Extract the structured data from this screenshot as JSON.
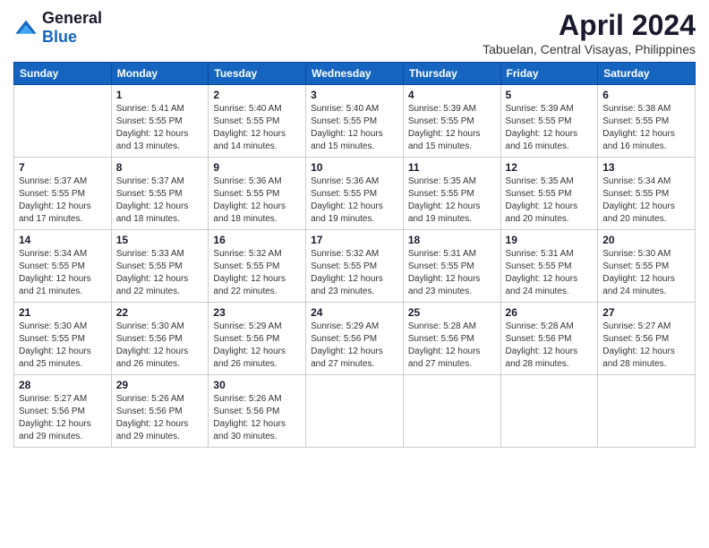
{
  "logo": {
    "general": "General",
    "blue": "Blue"
  },
  "title": "April 2024",
  "subtitle": "Tabuelan, Central Visayas, Philippines",
  "days_header": [
    "Sunday",
    "Monday",
    "Tuesday",
    "Wednesday",
    "Thursday",
    "Friday",
    "Saturday"
  ],
  "weeks": [
    [
      {
        "day": "",
        "empty": true
      },
      {
        "day": "1",
        "sunrise": "5:41 AM",
        "sunset": "5:55 PM",
        "daylight": "12 hours and 13 minutes."
      },
      {
        "day": "2",
        "sunrise": "5:40 AM",
        "sunset": "5:55 PM",
        "daylight": "12 hours and 14 minutes."
      },
      {
        "day": "3",
        "sunrise": "5:40 AM",
        "sunset": "5:55 PM",
        "daylight": "12 hours and 15 minutes."
      },
      {
        "day": "4",
        "sunrise": "5:39 AM",
        "sunset": "5:55 PM",
        "daylight": "12 hours and 15 minutes."
      },
      {
        "day": "5",
        "sunrise": "5:39 AM",
        "sunset": "5:55 PM",
        "daylight": "12 hours and 16 minutes."
      },
      {
        "day": "6",
        "sunrise": "5:38 AM",
        "sunset": "5:55 PM",
        "daylight": "12 hours and 16 minutes."
      }
    ],
    [
      {
        "day": "7",
        "sunrise": "5:37 AM",
        "sunset": "5:55 PM",
        "daylight": "12 hours and 17 minutes."
      },
      {
        "day": "8",
        "sunrise": "5:37 AM",
        "sunset": "5:55 PM",
        "daylight": "12 hours and 18 minutes."
      },
      {
        "day": "9",
        "sunrise": "5:36 AM",
        "sunset": "5:55 PM",
        "daylight": "12 hours and 18 minutes."
      },
      {
        "day": "10",
        "sunrise": "5:36 AM",
        "sunset": "5:55 PM",
        "daylight": "12 hours and 19 minutes."
      },
      {
        "day": "11",
        "sunrise": "5:35 AM",
        "sunset": "5:55 PM",
        "daylight": "12 hours and 19 minutes."
      },
      {
        "day": "12",
        "sunrise": "5:35 AM",
        "sunset": "5:55 PM",
        "daylight": "12 hours and 20 minutes."
      },
      {
        "day": "13",
        "sunrise": "5:34 AM",
        "sunset": "5:55 PM",
        "daylight": "12 hours and 20 minutes."
      }
    ],
    [
      {
        "day": "14",
        "sunrise": "5:34 AM",
        "sunset": "5:55 PM",
        "daylight": "12 hours and 21 minutes."
      },
      {
        "day": "15",
        "sunrise": "5:33 AM",
        "sunset": "5:55 PM",
        "daylight": "12 hours and 22 minutes."
      },
      {
        "day": "16",
        "sunrise": "5:32 AM",
        "sunset": "5:55 PM",
        "daylight": "12 hours and 22 minutes."
      },
      {
        "day": "17",
        "sunrise": "5:32 AM",
        "sunset": "5:55 PM",
        "daylight": "12 hours and 23 minutes."
      },
      {
        "day": "18",
        "sunrise": "5:31 AM",
        "sunset": "5:55 PM",
        "daylight": "12 hours and 23 minutes."
      },
      {
        "day": "19",
        "sunrise": "5:31 AM",
        "sunset": "5:55 PM",
        "daylight": "12 hours and 24 minutes."
      },
      {
        "day": "20",
        "sunrise": "5:30 AM",
        "sunset": "5:55 PM",
        "daylight": "12 hours and 24 minutes."
      }
    ],
    [
      {
        "day": "21",
        "sunrise": "5:30 AM",
        "sunset": "5:55 PM",
        "daylight": "12 hours and 25 minutes."
      },
      {
        "day": "22",
        "sunrise": "5:30 AM",
        "sunset": "5:56 PM",
        "daylight": "12 hours and 26 minutes."
      },
      {
        "day": "23",
        "sunrise": "5:29 AM",
        "sunset": "5:56 PM",
        "daylight": "12 hours and 26 minutes."
      },
      {
        "day": "24",
        "sunrise": "5:29 AM",
        "sunset": "5:56 PM",
        "daylight": "12 hours and 27 minutes."
      },
      {
        "day": "25",
        "sunrise": "5:28 AM",
        "sunset": "5:56 PM",
        "daylight": "12 hours and 27 minutes."
      },
      {
        "day": "26",
        "sunrise": "5:28 AM",
        "sunset": "5:56 PM",
        "daylight": "12 hours and 28 minutes."
      },
      {
        "day": "27",
        "sunrise": "5:27 AM",
        "sunset": "5:56 PM",
        "daylight": "12 hours and 28 minutes."
      }
    ],
    [
      {
        "day": "28",
        "sunrise": "5:27 AM",
        "sunset": "5:56 PM",
        "daylight": "12 hours and 29 minutes."
      },
      {
        "day": "29",
        "sunrise": "5:26 AM",
        "sunset": "5:56 PM",
        "daylight": "12 hours and 29 minutes."
      },
      {
        "day": "30",
        "sunrise": "5:26 AM",
        "sunset": "5:56 PM",
        "daylight": "12 hours and 30 minutes."
      },
      {
        "day": "",
        "empty": true
      },
      {
        "day": "",
        "empty": true
      },
      {
        "day": "",
        "empty": true
      },
      {
        "day": "",
        "empty": true
      }
    ]
  ],
  "labels": {
    "sunrise_prefix": "Sunrise: ",
    "sunset_prefix": "Sunset: ",
    "daylight_prefix": "Daylight: "
  }
}
